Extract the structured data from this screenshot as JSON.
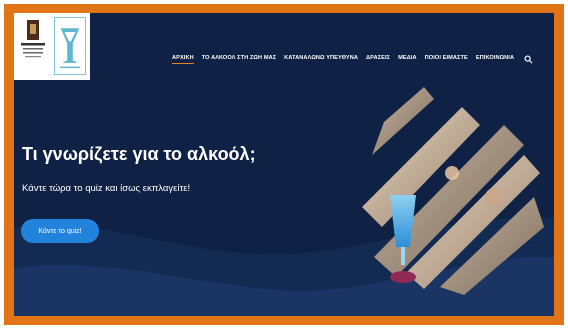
{
  "nav": {
    "items": [
      {
        "label": "ΑΡΧΙΚΗ",
        "active": true
      },
      {
        "label": "ΤΟ ΑΛΚΟΟΛ ΣΤΗ ΖΩΗ ΜΑΣ",
        "active": false
      },
      {
        "label": "ΚΑΤΑΝΑΛΩΝΩ ΥΠΕΥΘΥΝΑ",
        "active": false
      },
      {
        "label": "ΔΡΑΣΕΙΣ",
        "active": false
      },
      {
        "label": "ΜΕΔΙΑ",
        "active": false
      },
      {
        "label": "ΠΟΙΟΙ ΕΙΜΑΣΤΕ",
        "active": false
      },
      {
        "label": "ΕΠΙΚΟΙΝΩΝΙΑ",
        "active": false
      }
    ],
    "search_icon": "search-icon"
  },
  "hero": {
    "title": "Τι γνωρίζετε για το αλκοόλ;",
    "subtitle": "Κάντε τώρα το quiz και ίσως εκπλαγείτε!",
    "cta_label": "Κάντε το quiz!"
  },
  "colors": {
    "frame": "#e07416",
    "background": "#0f2144",
    "accent": "#e2862a",
    "cta": "#2283dc"
  }
}
